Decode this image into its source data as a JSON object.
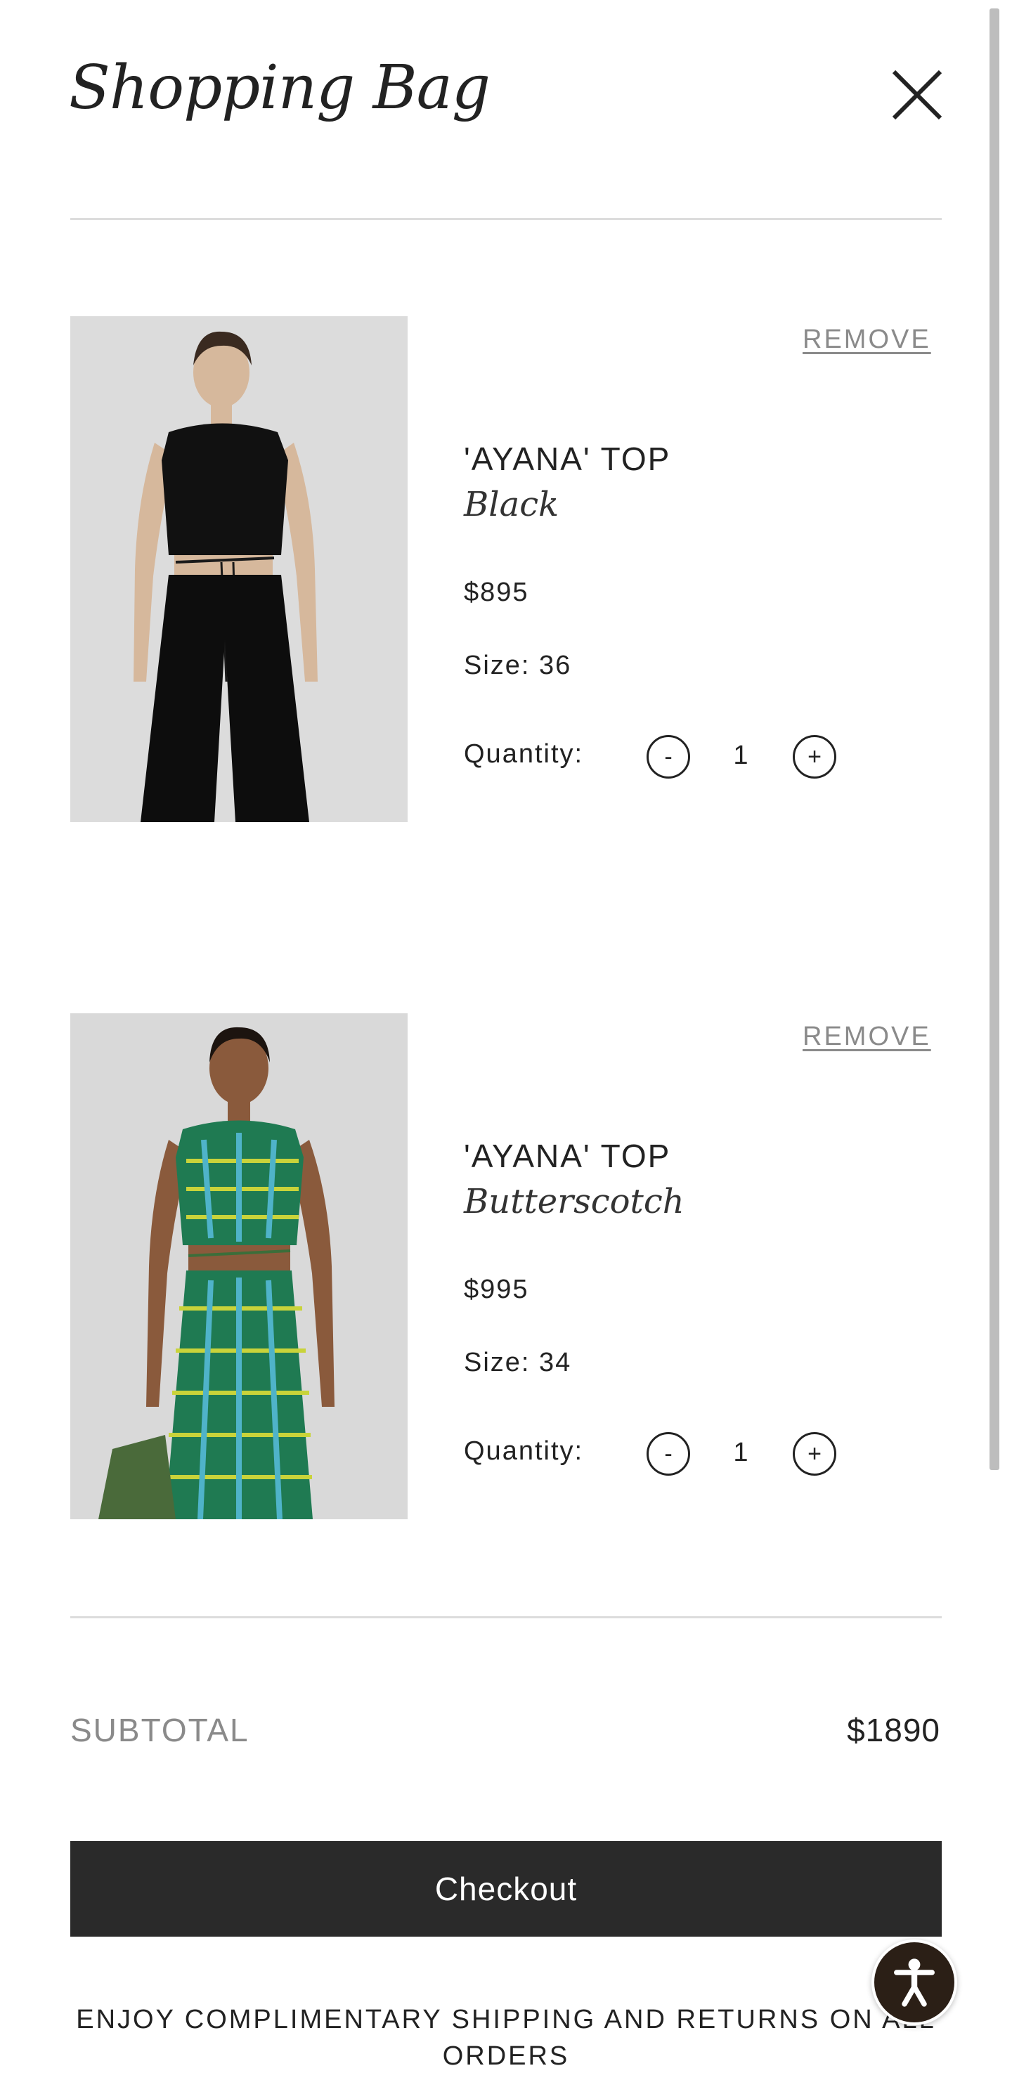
{
  "header": {
    "title": "Shopping Bag",
    "close_icon": "close-icon"
  },
  "cart": {
    "items": [
      {
        "image": "product-photo-model-black-top",
        "remove_label": "REMOVE",
        "name": "'AYANA' TOP",
        "color": "Black",
        "price": "$895",
        "size": "Size: 36",
        "quantity_label": "Quantity:",
        "quantity": "1",
        "decrement_label": "-",
        "increment_label": "+"
      },
      {
        "image": "product-photo-model-green-print-top",
        "remove_label": "REMOVE",
        "name": "'AYANA' TOP",
        "color": "Butterscotch",
        "price": "$995",
        "size": "Size: 34",
        "quantity_label": "Quantity:",
        "quantity": "1",
        "decrement_label": "-",
        "increment_label": "+"
      }
    ]
  },
  "summary": {
    "subtotal_label": "SUBTOTAL",
    "subtotal_value": "$1890",
    "checkout_label": "Checkout",
    "shipping_note": "ENJOY COMPLIMENTARY SHIPPING AND RETURNS ON ALL ORDERS"
  },
  "accessibility": {
    "icon": "accessibility-icon"
  },
  "colors": {
    "text": "#222222",
    "muted": "#8a8a8a",
    "checkout_bg": "#2a2a2a",
    "accessibility_bg": "#2b1f16"
  }
}
